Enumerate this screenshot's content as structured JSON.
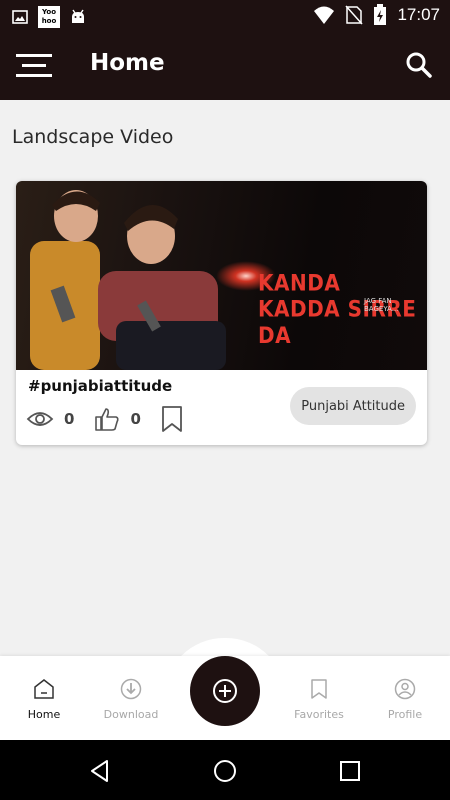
{
  "status_bar": {
    "time": "17:07",
    "left_icons": [
      "image-icon",
      "yoohoo-icon",
      "android-icon"
    ],
    "right_icons": [
      "wifi-icon",
      "no-sim-icon",
      "battery-charging-icon"
    ],
    "yoohoo_text": "Yoo hoo"
  },
  "app_bar": {
    "title": "Home",
    "bg_color": "#1e1111"
  },
  "section": {
    "title": "Landscape Video"
  },
  "video_card": {
    "thumbnail_text": "KANDA KADDA SIRRE DA",
    "thumbnail_subtext": "JAG FAN BAGEYA...",
    "hashtag": "#punjabiattitude",
    "views": "0",
    "likes": "0",
    "category": "Punjabi Attitude"
  },
  "bottom_nav": {
    "items": [
      {
        "label": "Home",
        "icon": "home-icon",
        "active": true
      },
      {
        "label": "Download",
        "icon": "download-icon",
        "active": false
      },
      {
        "label": "Favorites",
        "icon": "bookmark-icon",
        "active": false
      },
      {
        "label": "Profile",
        "icon": "profile-icon",
        "active": false
      }
    ],
    "fab_icon": "plus-circle-icon"
  },
  "system_nav": {
    "icons": [
      "back-icon",
      "home-circle-icon",
      "recents-icon"
    ]
  }
}
